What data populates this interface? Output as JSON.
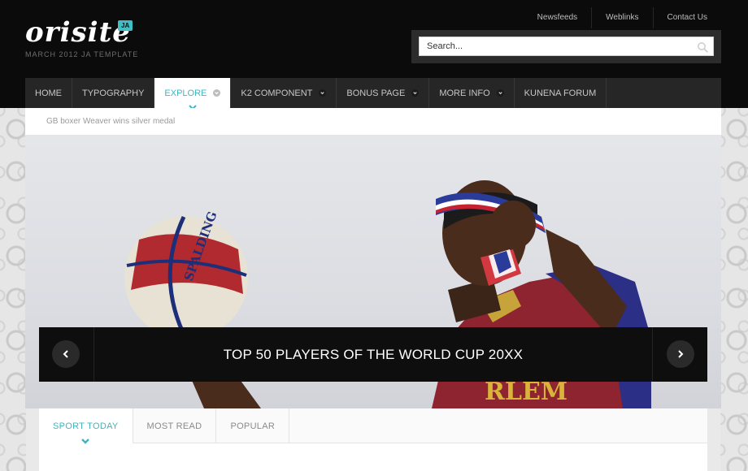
{
  "logo": {
    "name": "orisite",
    "badge": "JA",
    "subtitle": "MARCH 2012 JA TEMPLATE"
  },
  "toplinks": [
    "Newsfeeds",
    "Weblinks",
    "Contact Us"
  ],
  "search": {
    "placeholder": "Search..."
  },
  "nav": {
    "items": [
      {
        "label": "HOME",
        "has_dropdown": false
      },
      {
        "label": "TYPOGRAPHY",
        "has_dropdown": false
      },
      {
        "label": "EXPLORE",
        "has_dropdown": true,
        "active": true
      },
      {
        "label": "K2 COMPONENT",
        "has_dropdown": true
      },
      {
        "label": "BONUS PAGE",
        "has_dropdown": true
      },
      {
        "label": "MORE INFO",
        "has_dropdown": true
      },
      {
        "label": "KUNENA FORUM",
        "has_dropdown": false
      }
    ]
  },
  "ticker": {
    "headline": "GB boxer Weaver wins silver medal"
  },
  "slideshow": {
    "caption": "TOP 50 PLAYERS OF THE WORLD CUP 20XX",
    "prev_icon": "chevron-left-icon",
    "next_icon": "chevron-right-icon"
  },
  "tabs": {
    "items": [
      {
        "label": "SPORT TODAY",
        "active": true
      },
      {
        "label": "MOST READ"
      },
      {
        "label": "POPULAR"
      }
    ]
  },
  "colors": {
    "accent": "#3fb6bf",
    "header_bg": "#0b0b0c",
    "nav_bg": "#262626"
  }
}
